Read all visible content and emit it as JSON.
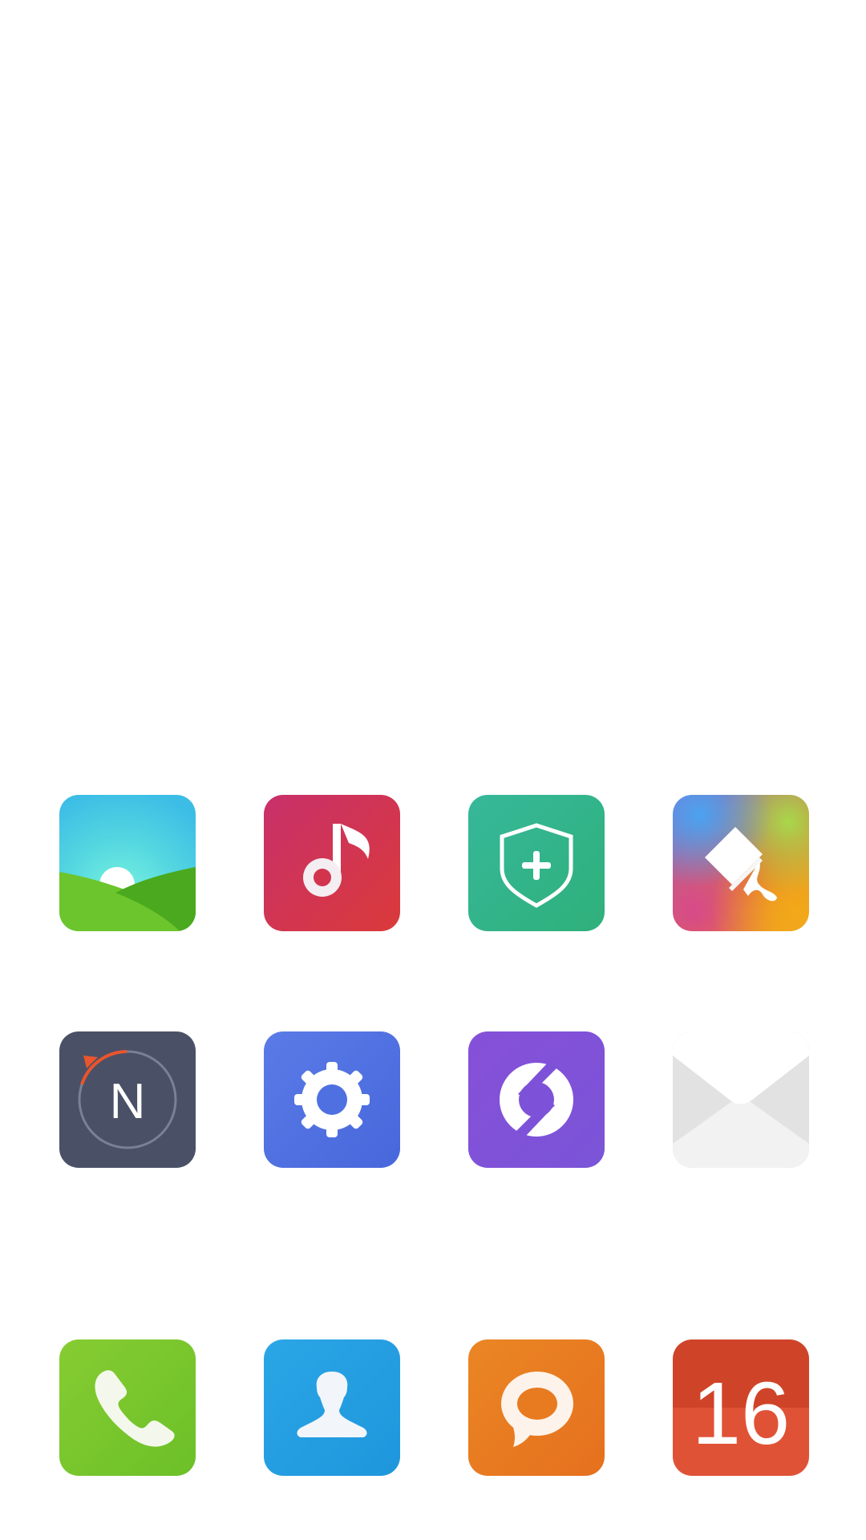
{
  "home_screen": {
    "icons": [
      {
        "app": "gallery",
        "icon": "landscape-icon"
      },
      {
        "app": "music",
        "icon": "music-note-icon"
      },
      {
        "app": "security",
        "icon": "shield-plus-icon"
      },
      {
        "app": "themes",
        "icon": "paint-brush-icon"
      },
      {
        "app": "compass",
        "icon": "compass-icon",
        "glyph": "N"
      },
      {
        "app": "settings",
        "icon": "gear-icon"
      },
      {
        "app": "sync",
        "icon": "sync-icon"
      },
      {
        "app": "email",
        "icon": "envelope-icon"
      },
      {
        "app": "phone",
        "icon": "phone-handset-icon"
      },
      {
        "app": "contacts",
        "icon": "person-silhouette-icon"
      },
      {
        "app": "messaging",
        "icon": "speech-bubble-icon"
      },
      {
        "app": "calendar",
        "icon": "calendar-icon",
        "date": "16"
      }
    ]
  },
  "colors": {
    "background": "#ffffff",
    "music": "#d2344e",
    "security": "#32b38a",
    "compass": "#4a5066",
    "compass_accent": "#e8552e",
    "settings": "#4f70e0",
    "sync": "#7e52d8",
    "phone": "#78c42c",
    "contacts": "#239ee0",
    "messaging": "#e87a20",
    "calendar_top": "#cf4428",
    "calendar_bottom": "#e05236"
  }
}
